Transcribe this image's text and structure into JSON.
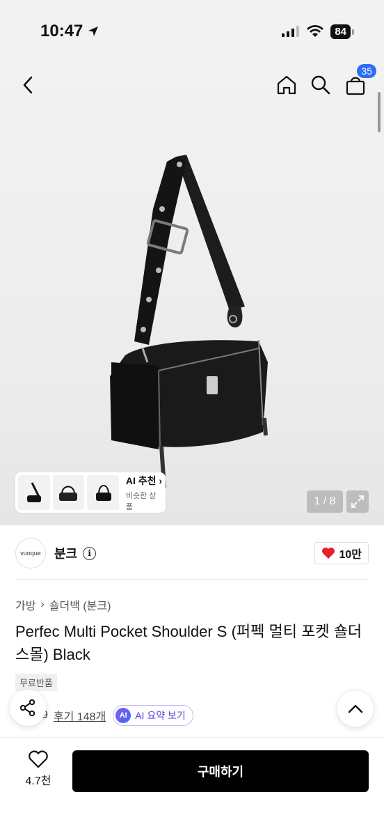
{
  "status_bar": {
    "time": "10:47",
    "battery": "84",
    "icons": [
      "location-arrow-icon",
      "signal-icon",
      "wifi-icon",
      "battery-icon"
    ]
  },
  "nav": {
    "icons": [
      "back-chevron-icon",
      "home-icon",
      "search-icon",
      "shopping-bag-icon"
    ],
    "cart_count": "35"
  },
  "gallery": {
    "ai_recommend_title": "AI 추천",
    "ai_recommend_sub": "비슷한 상품",
    "counter": "1 / 8",
    "thumbnails_count": 3
  },
  "seller": {
    "logo_text": "vunque",
    "name": "분크",
    "likes": "10만"
  },
  "breadcrumb": [
    "가방",
    "숄더백 (분크)"
  ],
  "product": {
    "title": "Perfec Multi Pocket Shoulder S (퍼펙 멀티 포켓 숄더 스몰) Black",
    "tag": "무료반품",
    "rating_partial": "9",
    "reviews": "후기 148개",
    "ai_badge": "AI",
    "ai_summary": "AI 요약 보기"
  },
  "bottom_bar": {
    "wish_count": "4.7천",
    "buy_label": "구매하기"
  },
  "colors": {
    "accent_blue": "#2f6cf6",
    "heart_red": "#e5202e",
    "ai_purple": "#5b3fd6",
    "buy_black": "#000000"
  }
}
